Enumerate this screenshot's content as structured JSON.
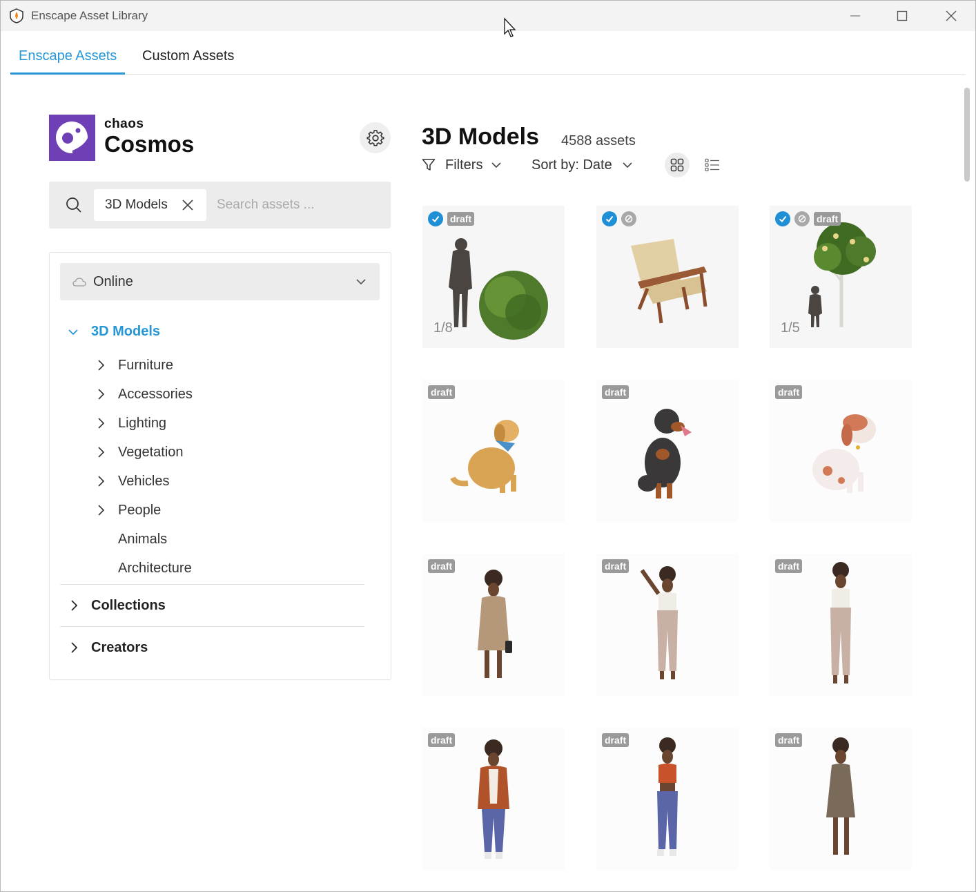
{
  "window": {
    "title": "Enscape Asset Library"
  },
  "tabs": [
    {
      "label": "Enscape Assets",
      "active": true
    },
    {
      "label": "Custom Assets",
      "active": false
    }
  ],
  "brand": {
    "small": "chaos",
    "big": "Cosmos",
    "color": "#6f3fb6"
  },
  "search": {
    "chip": "3D Models",
    "placeholder": "Search assets ..."
  },
  "source": {
    "selected": "Online"
  },
  "tree": {
    "root": "3D Models",
    "children": [
      "Furniture",
      "Accessories",
      "Lighting",
      "Vegetation",
      "Vehicles",
      "People",
      "Animals",
      "Architecture"
    ],
    "sections": [
      "Collections",
      "Creators"
    ]
  },
  "content": {
    "title": "3D Models",
    "count": "4588 assets",
    "filters_label": "Filters",
    "sort_label": "Sort by: Date"
  },
  "assets": [
    {
      "badges": [
        "check",
        "draft"
      ],
      "counter": "1/8",
      "art": "person-and-bush"
    },
    {
      "badges": [
        "check",
        "status"
      ],
      "counter": "",
      "art": "armchair"
    },
    {
      "badges": [
        "check",
        "status",
        "draft"
      ],
      "counter": "1/5",
      "art": "person-and-tree"
    },
    {
      "badges": [
        "draft"
      ],
      "counter": "",
      "art": "golden-retriever"
    },
    {
      "badges": [
        "draft"
      ],
      "counter": "",
      "art": "rottweiler"
    },
    {
      "badges": [
        "draft"
      ],
      "counter": "",
      "art": "pointer-dog"
    },
    {
      "badges": [
        "draft"
      ],
      "counter": "",
      "art": "woman-coat"
    },
    {
      "badges": [
        "draft"
      ],
      "counter": "",
      "art": "woman-pointing"
    },
    {
      "badges": [
        "draft"
      ],
      "counter": "",
      "art": "woman-standing"
    },
    {
      "badges": [
        "draft"
      ],
      "counter": "",
      "art": "woman-jacket"
    },
    {
      "badges": [
        "draft"
      ],
      "counter": "",
      "art": "woman-crop-top"
    },
    {
      "badges": [
        "draft"
      ],
      "counter": "",
      "art": "woman-dress"
    }
  ],
  "draft_label": "draft",
  "accent": "#2597d6"
}
